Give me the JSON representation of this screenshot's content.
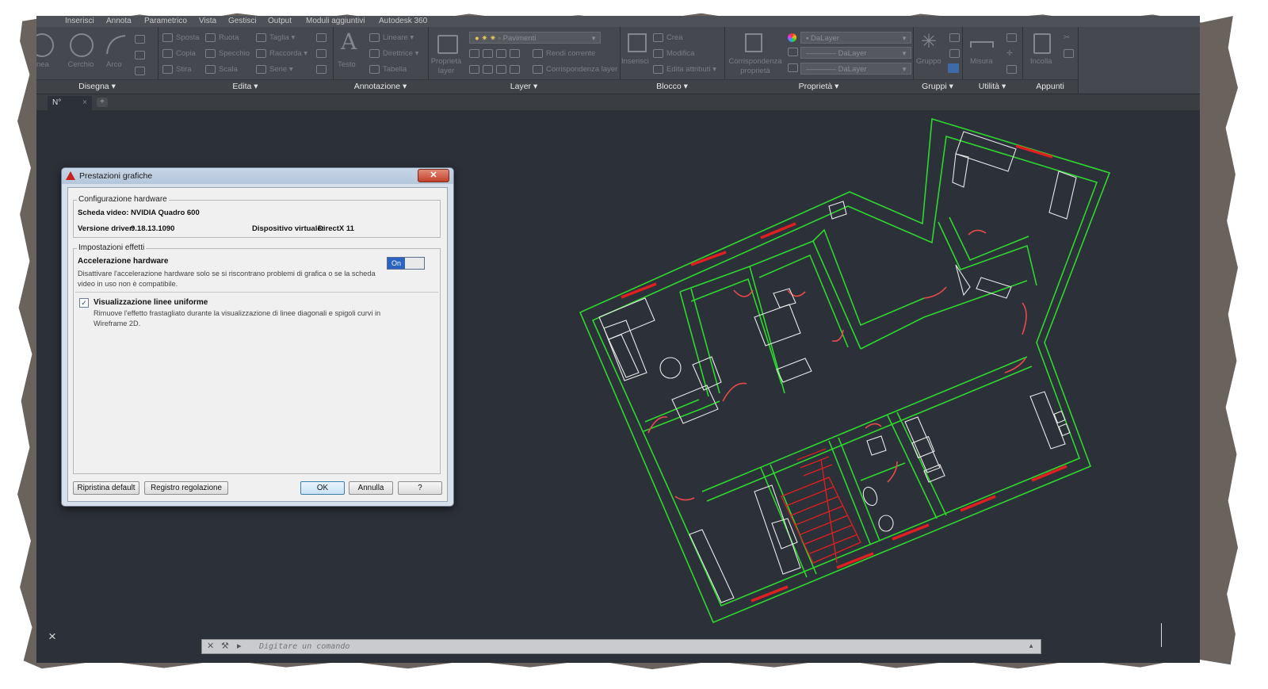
{
  "app": {
    "menu": [
      "Inserisci",
      "Annota",
      "Parametrico",
      "Vista",
      "Gestisci",
      "Output",
      "Moduli aggiuntivi",
      "Autodesk 360"
    ],
    "file_tab": "N°",
    "close_symbol": "×"
  },
  "ribbon": {
    "panels": [
      "Disegna",
      "Edita",
      "Annotazione",
      "Layer",
      "Blocco",
      "Proprietà",
      "Gruppi",
      "Utilità",
      "Appunti"
    ],
    "disegna": {
      "linea": "nea",
      "cerchio": "Cerchio",
      "arco": "Arco"
    },
    "edita": {
      "sposta": "Sposta",
      "ruota": "Ruota",
      "taglia": "Taglia",
      "copia": "Copia",
      "specchio": "Specchio",
      "raccorda": "Raccorda",
      "stira": "Stira",
      "scala": "Scala",
      "serie": "Serie"
    },
    "annotazione": {
      "testo": "Testo",
      "lineare": "Lineare",
      "direttrice": "Direttrice",
      "tabella": "Tabella"
    },
    "layer": {
      "proprieta_layer": "Proprietà layer",
      "layer_name": "Pavimenti",
      "rendi_corrente": "Rendi corrente",
      "corrispondenza_layer": "Corrispondenza layer"
    },
    "blocco": {
      "inserisci": "Inserisci",
      "crea": "Crea",
      "modifica": "Modifica",
      "edita_attributi": "Edita attributi"
    },
    "proprieta": {
      "corrispondenza": "Corrispondenza proprietà",
      "color": "DaLayer",
      "linetype": "DaLayer",
      "lineweight": "DaLayer"
    },
    "gruppi": {
      "gruppo": "Gruppo"
    },
    "utilita": {
      "misura": "Misura"
    },
    "appunti": {
      "incolla": "Incolla"
    }
  },
  "dialog": {
    "title": "Prestazioni grafiche",
    "close_symbol": "✕",
    "hardware": {
      "group_label": "Configurazione hardware",
      "card_label": "Scheda video:",
      "card_value": "NVIDIA Quadro 600",
      "driver_label": "Versione driver:",
      "driver_value": "9.18.13.1090",
      "device_label": "Dispositivo virtuale:",
      "device_value": "DirectX 11"
    },
    "effects": {
      "group_label": "Impostazioni effetti",
      "accel_title": "Accelerazione hardware",
      "accel_desc": "Disattivare l'accelerazione hardware solo se si riscontrano problemi di grafica o se la scheda video in uso non è compatibile.",
      "accel_state": "On",
      "smooth_title": "Visualizzazione linee uniforme",
      "smooth_checked": true,
      "smooth_desc": "Rimuove l'effetto frastagliato durante la visualizzazione di linee diagonali e spigoli curvi in Wireframe 2D."
    },
    "buttons": {
      "reset": "Ripristina default",
      "tuning_log": "Registro regolazione",
      "ok": "OK",
      "cancel": "Annulla",
      "help": "?"
    }
  },
  "command_line": {
    "placeholder": "Digitare un comando"
  },
  "colors": {
    "canvas": "#2c3039",
    "wall": "#2ed82e",
    "furniture": "#e8e8e8",
    "door": "#e84a4a",
    "window": "#e02020",
    "ribbon": "#45484e"
  }
}
